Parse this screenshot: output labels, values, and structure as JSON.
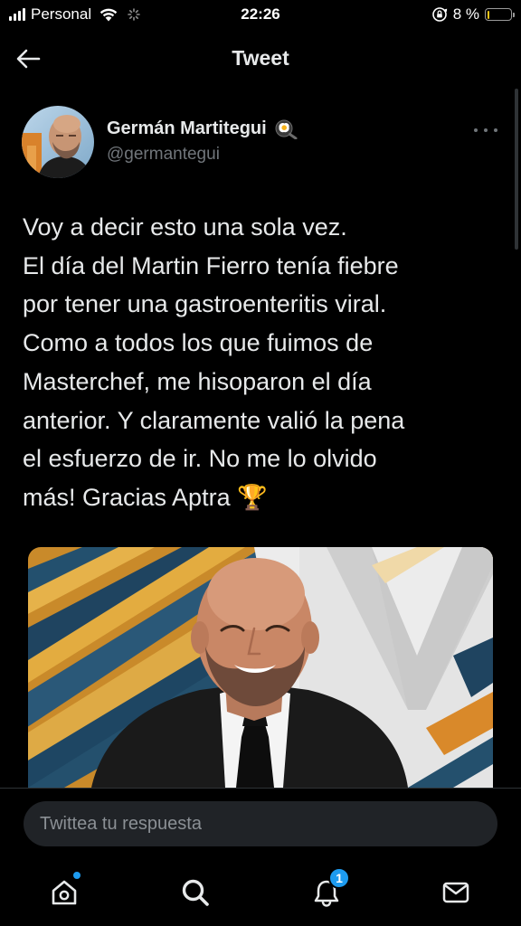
{
  "status_bar": {
    "carrier": "Personal",
    "time": "22:26",
    "battery_percent": "8 %",
    "battery_level": 0.08,
    "battery_color": "#f5c518",
    "icons": [
      "signal-bars-icon",
      "wifi-icon",
      "loading-spinner-icon",
      "orientation-lock-icon",
      "battery-icon"
    ]
  },
  "header": {
    "title": "Tweet",
    "back_icon": "back-arrow-icon"
  },
  "tweet": {
    "author_name": "Germán Martitegui",
    "author_emoji": "🍳",
    "author_handle": "@germantegui",
    "more_icon": "more-horizontal-icon",
    "text_lines": [
      "Voy a decir esto una sola vez.",
      "El día del Martin Fierro tenía fiebre",
      "por tener una gastroenteritis viral.",
      "Como a todos los que fuimos de",
      "Masterchef, me hisoparon el día",
      "anterior. Y claramente valió la pena",
      "el esfuerzo de ir. No me lo olvido",
      "más! Gracias Aptra 🏆"
    ],
    "media": {
      "type": "photo",
      "subject": "bald bearded man in black suit and tie smiling"
    }
  },
  "reply": {
    "placeholder": "Twittea tu respuesta"
  },
  "bottom_nav": {
    "items": [
      {
        "name": "home",
        "icon": "home-icon",
        "has_dot": true
      },
      {
        "name": "search",
        "icon": "search-icon"
      },
      {
        "name": "notifications",
        "icon": "bell-icon",
        "badge": "1"
      },
      {
        "name": "messages",
        "icon": "mail-icon"
      }
    ]
  },
  "colors": {
    "background": "#000000",
    "text_primary": "#e7e9ea",
    "text_secondary": "#71767b",
    "accent": "#1d9bf0",
    "input_background": "#202327",
    "divider": "#2f3336"
  }
}
